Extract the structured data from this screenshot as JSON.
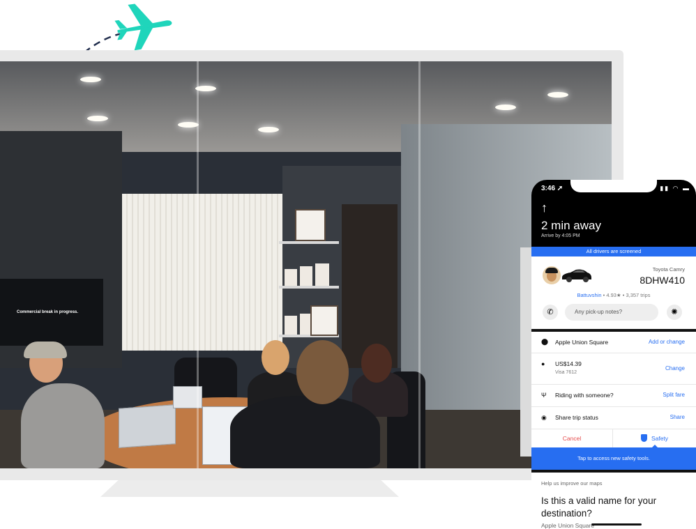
{
  "screen_photo": {
    "tv_caption": "Commercial break in progress."
  },
  "phone": {
    "status": {
      "time": "3:46 ➚",
      "icons": "▮▮ ◠ ▬"
    },
    "trip": {
      "back_icon": "arrow-up-icon",
      "eta": "2 min away",
      "arrive": "Arrive by 4:05 PM",
      "screened": "All drivers are screened"
    },
    "driver": {
      "car_model": "Toyota Camry",
      "plate": "8DHW410",
      "name": "Battuvshin",
      "details": "• 4.93★ • 3,357 trips",
      "notes_placeholder": "Any pick-up notes?"
    },
    "rows": {
      "destination": {
        "label": "Apple Union Square",
        "action": "Add or change"
      },
      "payment": {
        "label": "US$14.39",
        "sub": "Visa 7612",
        "action": "Change"
      },
      "riding": {
        "label": "Riding with someone?",
        "action": "Split fare"
      },
      "share": {
        "label": "Share trip status",
        "action": "Share"
      }
    },
    "buttons": {
      "cancel": "Cancel",
      "safety": "Safety"
    },
    "tap_bar": "Tap to access new safety tools.",
    "improve": "Help us improve our maps",
    "question": "Is this a valid name for your destination?",
    "destination_name": "Apple Union Square"
  },
  "colors": {
    "accent": "#276ef1",
    "plane": "#1fd5bb",
    "cancel": "#e54b4b"
  }
}
